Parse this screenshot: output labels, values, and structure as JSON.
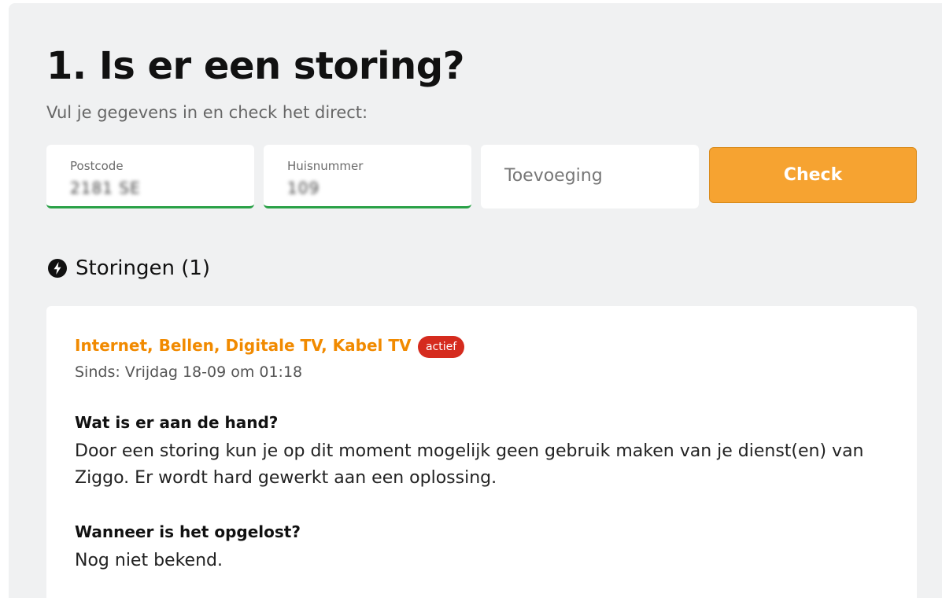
{
  "header": {
    "title": "1. Is er een storing?",
    "subtitle": "Vul je gegevens in en check het direct:"
  },
  "form": {
    "postcode": {
      "label": "Postcode",
      "value": "2181 SE"
    },
    "huisnummer": {
      "label": "Huisnummer",
      "value": "109"
    },
    "toevoeging": {
      "placeholder": "Toevoeging"
    },
    "check_label": "Check"
  },
  "storingen": {
    "heading": "Storingen (1)",
    "icon": "bolt-icon",
    "items": [
      {
        "services": "Internet, Bellen, Digitale TV, Kabel TV",
        "status": "actief",
        "since": "Sinds: Vrijdag 18-09 om 01:18",
        "q1_heading": "Wat is er aan de hand?",
        "q1_body": "Door een storing kun je op dit moment mogelijk geen gebruik maken van je dienst(en) van Ziggo. Er wordt hard gewerkt aan een oplossing.",
        "q2_heading": "Wanneer is het opgelost?",
        "q2_body": "Nog niet bekend."
      }
    ]
  },
  "colors": {
    "accent": "#f6a331",
    "service_text": "#f18a00",
    "badge": "#d52b1e",
    "valid": "#2aa147",
    "panel_bg": "#f0f1f2"
  }
}
